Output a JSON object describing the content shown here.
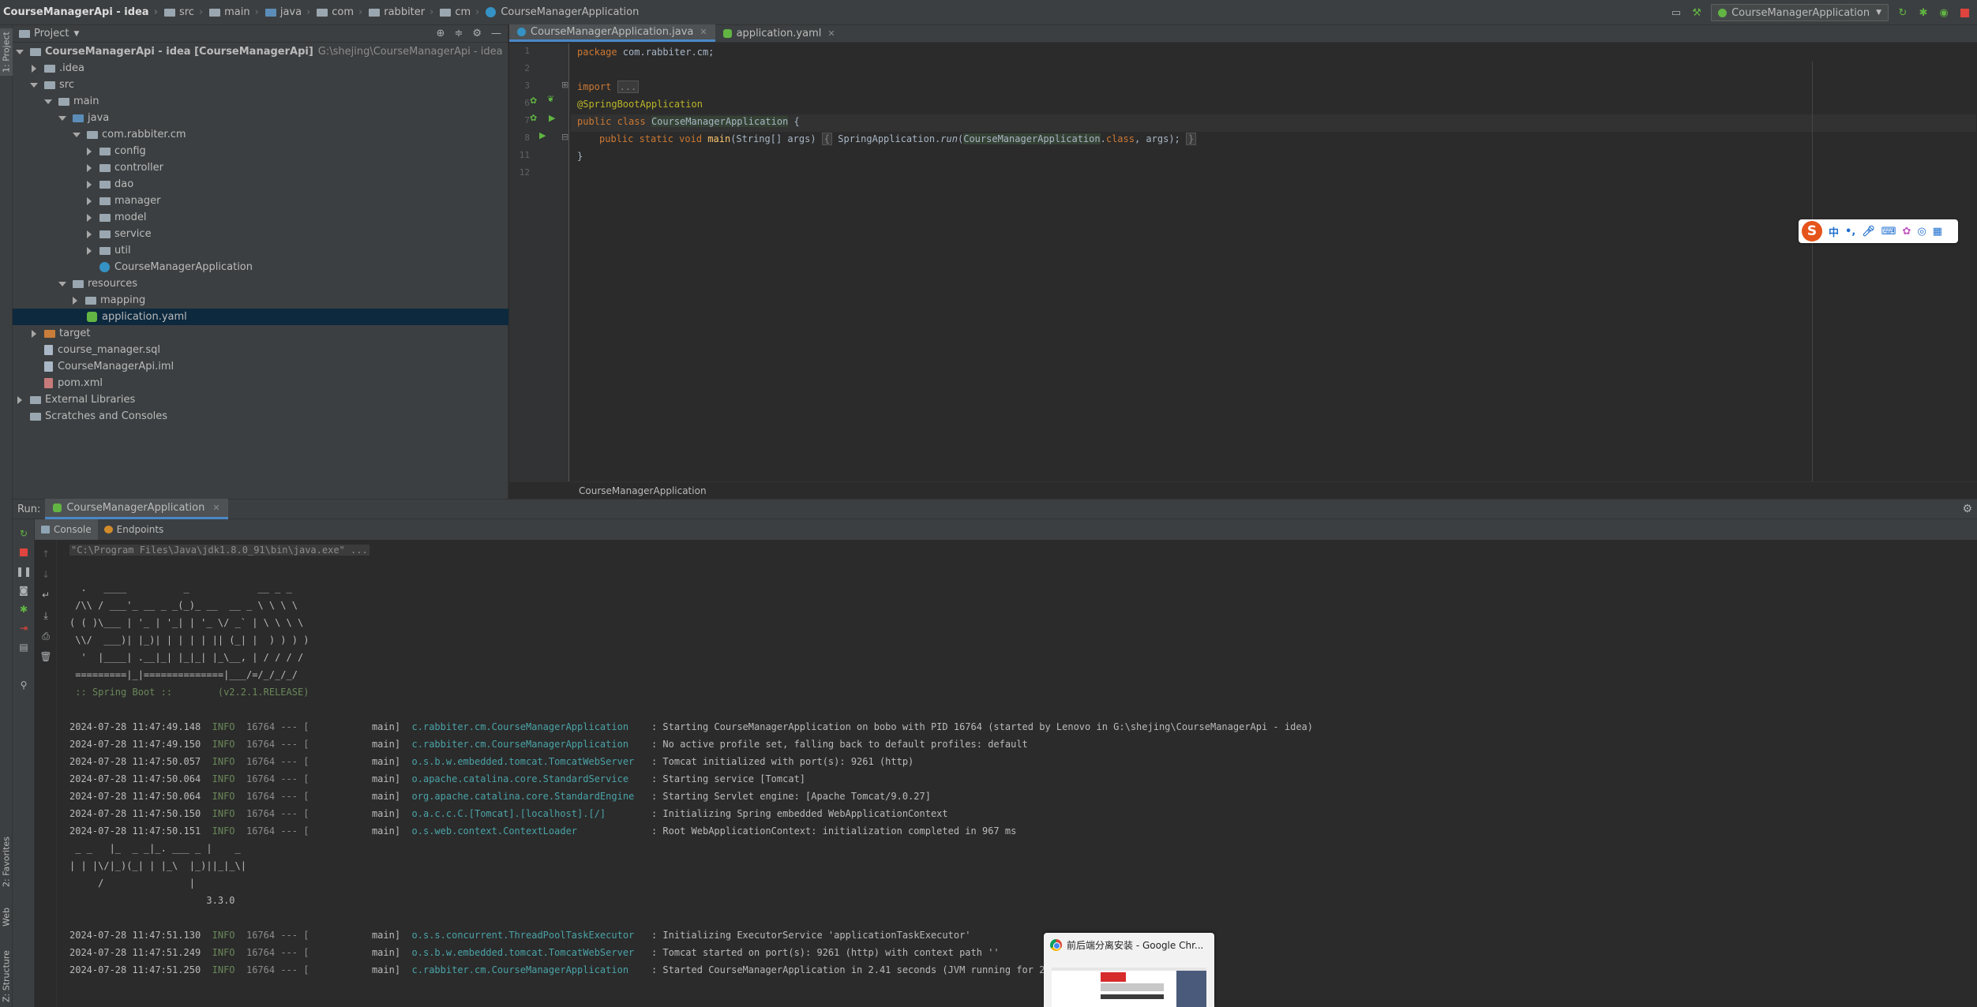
{
  "navbar": {
    "crumbs": [
      "CourseManagerApi - idea",
      "src",
      "main",
      "java",
      "com",
      "rabbiter",
      "cm",
      "CourseManagerApplication"
    ],
    "run_config": "CourseManagerApplication"
  },
  "left_stripe": {
    "project_tab": "1: Project",
    "favorites_tab": "2: Favorites",
    "web_tab": "Web",
    "structure_tab": "Z: Structure"
  },
  "project": {
    "header": "Project",
    "tree": [
      {
        "label": "CourseManagerApi - idea [CourseManagerApi]",
        "extra": "G:\\shejing\\CourseManagerApi - idea"
      },
      {
        "label": ".idea"
      },
      {
        "label": "src"
      },
      {
        "label": "main"
      },
      {
        "label": "java"
      },
      {
        "label": "com.rabbiter.cm"
      },
      {
        "label": "config"
      },
      {
        "label": "controller"
      },
      {
        "label": "dao"
      },
      {
        "label": "manager"
      },
      {
        "label": "model"
      },
      {
        "label": "service"
      },
      {
        "label": "util"
      },
      {
        "label": "CourseManagerApplication"
      },
      {
        "label": "resources"
      },
      {
        "label": "mapping"
      },
      {
        "label": "application.yaml"
      },
      {
        "label": "target"
      },
      {
        "label": "course_manager.sql"
      },
      {
        "label": "CourseManagerApi.iml"
      },
      {
        "label": "pom.xml"
      },
      {
        "label": "External Libraries"
      },
      {
        "label": "Scratches and Consoles"
      }
    ]
  },
  "editor": {
    "tabs": [
      {
        "label": "CourseManagerApplication.java"
      },
      {
        "label": "application.yaml"
      }
    ],
    "line_numbers": [
      "1",
      "2",
      "3",
      "6",
      "7",
      "8",
      "11",
      "12"
    ],
    "code": {
      "l1_kw": "package",
      "l1_rest": " com.rabbiter.cm;",
      "l3_kw": "import",
      "l3_fold": "...",
      "l6": "@SpringBootApplication",
      "l7_kw": "public class",
      "l7_cls": "CourseManagerApplication",
      "l7_rest": " {",
      "l8_kw": "public static void",
      "l8_fn": "main",
      "l8_a": "(String[] args) ",
      "l8_fold_open": "{",
      "l8_b": " SpringApplication.",
      "l8_run": "run",
      "l8_c": "(",
      "l8_cls": "CourseManagerApplication",
      "l8_d": ".",
      "l8_kw2": "class",
      "l8_e": ", args); ",
      "l8_fold_close": "}",
      "l11": "}"
    },
    "breadcrumb": "CourseManagerApplication"
  },
  "ime": {
    "lang": "中"
  },
  "run": {
    "label": "Run:",
    "tab": "CourseManagerApplication",
    "subtabs": [
      "Console",
      "Endpoints"
    ],
    "console": {
      "cmd": "\"C:\\Program Files\\Java\\jdk1.8.0_91\\bin\\java.exe\" ...",
      "banner": [
        "  .   ____          _            __ _ _",
        " /\\\\ / ___'_ __ _ _(_)_ __  __ _ \\ \\ \\ \\",
        "( ( )\\___ | '_ | '_| | '_ \\/ _` | \\ \\ \\ \\",
        " \\\\/  ___)| |_)| | | | | || (_| |  ) ) ) )",
        "  '  |____| .__|_| |_|_| |_\\__, | / / / /",
        " =========|_|==============|___/=/_/_/_/"
      ],
      "spring_boot": " :: Spring Boot ::        (v2.2.1.RELEASE)",
      "logs": [
        {
          "ts": "2024-07-28 11:47:49.148",
          "level": "INFO",
          "pid": "16764 --- [",
          "thread": "           main]",
          "logger": "c.rabbiter.cm.CourseManagerApplication  ",
          "msg": ": Starting CourseManagerApplication on bobo with PID 16764 (started by Lenovo in G:\\shejing\\CourseManagerApi - idea)"
        },
        {
          "ts": "2024-07-28 11:47:49.150",
          "level": "INFO",
          "pid": "16764 --- [",
          "thread": "           main]",
          "logger": "c.rabbiter.cm.CourseManagerApplication  ",
          "msg": ": No active profile set, falling back to default profiles: default"
        },
        {
          "ts": "2024-07-28 11:47:50.057",
          "level": "INFO",
          "pid": "16764 --- [",
          "thread": "           main]",
          "logger": "o.s.b.w.embedded.tomcat.TomcatWebServer ",
          "msg": ": Tomcat initialized with port(s): 9261 (http)"
        },
        {
          "ts": "2024-07-28 11:47:50.064",
          "level": "INFO",
          "pid": "16764 --- [",
          "thread": "           main]",
          "logger": "o.apache.catalina.core.StandardService  ",
          "msg": ": Starting service [Tomcat]"
        },
        {
          "ts": "2024-07-28 11:47:50.064",
          "level": "INFO",
          "pid": "16764 --- [",
          "thread": "           main]",
          "logger": "org.apache.catalina.core.StandardEngine ",
          "msg": ": Starting Servlet engine: [Apache Tomcat/9.0.27]"
        },
        {
          "ts": "2024-07-28 11:47:50.150",
          "level": "INFO",
          "pid": "16764 --- [",
          "thread": "           main]",
          "logger": "o.a.c.c.C.[Tomcat].[localhost].[/]      ",
          "msg": ": Initializing Spring embedded WebApplicationContext"
        },
        {
          "ts": "2024-07-28 11:47:50.151",
          "level": "INFO",
          "pid": "16764 --- [",
          "thread": "           main]",
          "logger": "o.s.web.context.ContextLoader           ",
          "msg": ": Root WebApplicationContext: initialization completed in 967 ms"
        }
      ],
      "mybatis": [
        " _ _   |_  _ _|_. ___ _ |    _",
        "| | |\\/|_)(_| | |_\\  |_)||_|_\\|",
        "     /               |",
        "                        3.3.0"
      ],
      "logs2": [
        {
          "ts": "2024-07-28 11:47:51.130",
          "level": "INFO",
          "pid": "16764 --- [",
          "thread": "           main]",
          "logger": "o.s.s.concurrent.ThreadPoolTaskExecutor ",
          "msg": ": Initializing ExecutorService 'applicationTaskExecutor'"
        },
        {
          "ts": "2024-07-28 11:47:51.249",
          "level": "INFO",
          "pid": "16764 --- [",
          "thread": "           main]",
          "logger": "o.s.b.w.embedded.tomcat.TomcatWebServer ",
          "msg": ": Tomcat started on port(s): 9261 (http) with context path ''"
        },
        {
          "ts": "2024-07-28 11:47:51.250",
          "level": "INFO",
          "pid": "16764 --- [",
          "thread": "           main]",
          "logger": "c.rabbiter.cm.CourseManagerApplication  ",
          "msg": ": Started CourseManagerApplication in 2.41 seconds (JVM running for 2.912)"
        }
      ]
    }
  },
  "chrome_popup": {
    "title": "前后端分离安装 - Google Chr..."
  },
  "colors": {
    "accent": "#4a88c7",
    "selection": "#0d293e",
    "info": "#6a8759",
    "logger": "#4aa3a8"
  }
}
